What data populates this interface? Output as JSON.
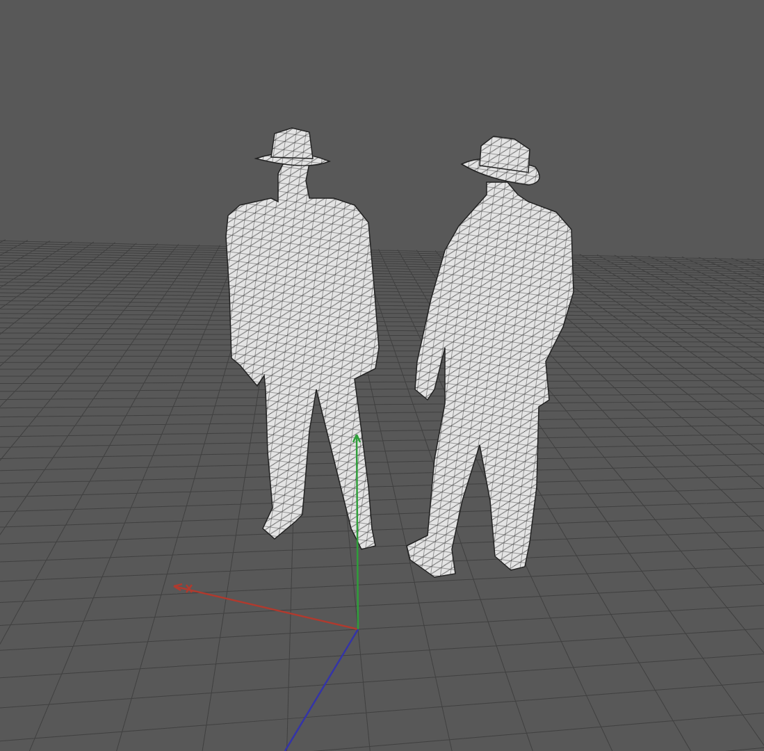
{
  "viewport": {
    "grid": {
      "visible": true
    },
    "axes": [
      {
        "kind": "x",
        "color": "#b03a2e"
      },
      {
        "kind": "y",
        "color": "#2f9e3a"
      },
      {
        "kind": "z",
        "color": "#3434a8"
      }
    ],
    "figures": [
      {
        "kind": "facing"
      },
      {
        "kind": "turned-away"
      }
    ]
  }
}
